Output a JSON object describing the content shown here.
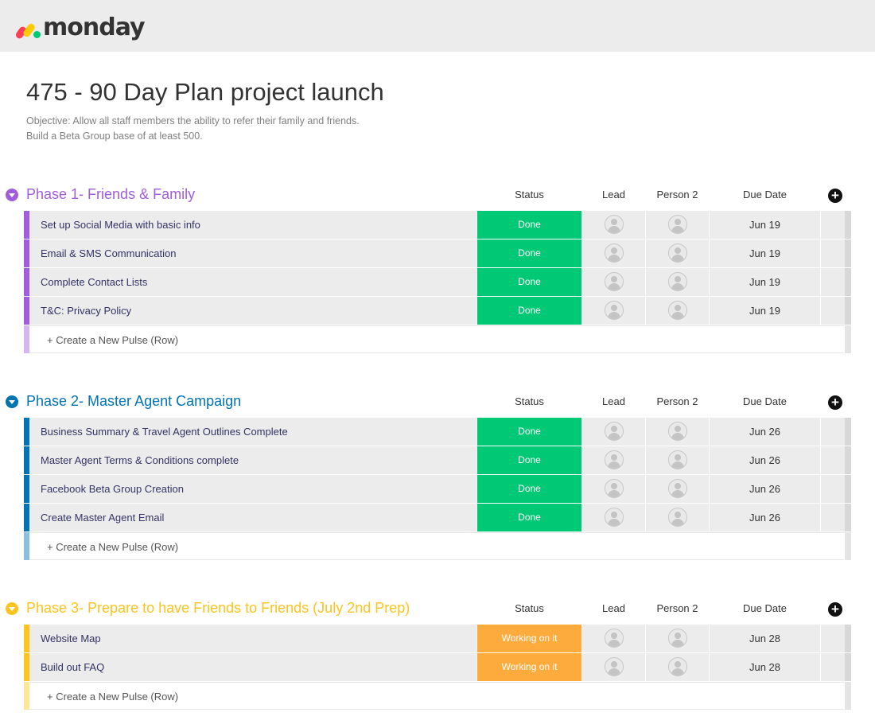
{
  "app": {
    "logo_text": "monday",
    "logo_colors": [
      "#ff3d57",
      "#ffcb00",
      "#00ca72"
    ]
  },
  "board": {
    "title": "475 - 90 Day Plan project launch",
    "description_line1": "Objective: Allow all staff members the ability to refer their family and friends.",
    "description_line2": "Build a Beta Group base of at least 500."
  },
  "columns": {
    "status": "Status",
    "lead": "Lead",
    "person2": "Person 2",
    "due_date": "Due Date",
    "add_column_icon": "plus-circle-icon"
  },
  "new_row_label": "+ Create a New Pulse (Row)",
  "groups": [
    {
      "title": "Phase 1- Friends & Family",
      "color": "#a25ddc",
      "light_color": "#d3b7ee",
      "rows": [
        {
          "name": "Set up Social Media with basic info",
          "status": "Done",
          "status_color": "#00c875",
          "due": "Jun 19"
        },
        {
          "name": "Email & SMS Communication",
          "status": "Done",
          "status_color": "#00c875",
          "due": "Jun 19"
        },
        {
          "name": "Complete Contact Lists",
          "status": "Done",
          "status_color": "#00c875",
          "due": "Jun 19"
        },
        {
          "name": "T&C: Privacy Policy",
          "status": "Done",
          "status_color": "#00c875",
          "due": "Jun 19"
        }
      ]
    },
    {
      "title": "Phase 2- Master Agent Campaign",
      "color": "#0073b1",
      "light_color": "#8cbfdd",
      "rows": [
        {
          "name": "Business Summary & Travel Agent Outlines Complete",
          "status": "Done",
          "status_color": "#00c875",
          "due": "Jun 26"
        },
        {
          "name": "Master Agent Terms & Conditions complete",
          "status": "Done",
          "status_color": "#00c875",
          "due": "Jun 26"
        },
        {
          "name": "Facebook Beta Group Creation",
          "status": "Done",
          "status_color": "#00c875",
          "due": "Jun 26"
        },
        {
          "name": "Create Master Agent Email",
          "status": "Done",
          "status_color": "#00c875",
          "due": "Jun 26"
        }
      ]
    },
    {
      "title": "Phase 3- Prepare to have Friends to Friends (July 2nd Prep)",
      "color": "#fcc41d",
      "light_color": "#fde89a",
      "rows": [
        {
          "name": "Website Map",
          "status": "Working on it",
          "status_color": "#fdab3d",
          "due": "Jun 28"
        },
        {
          "name": "Build out FAQ",
          "status": "Working on it",
          "status_color": "#fdab3d",
          "due": "Jun 28"
        }
      ]
    }
  ]
}
